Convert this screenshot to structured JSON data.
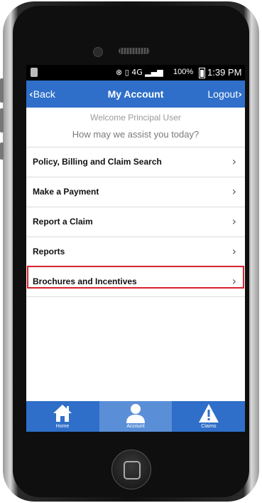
{
  "statusbar": {
    "battery": "100%",
    "time": "1:39 PM",
    "network": "4G"
  },
  "navbar": {
    "back_label": "Back",
    "title": "My Account",
    "logout_label": "Logout"
  },
  "welcome_text": "Welcome Principal User",
  "assist_text": "How may we assist you today?",
  "menu": {
    "items": [
      {
        "label": "Policy, Billing and Claim Search"
      },
      {
        "label": "Make a Payment"
      },
      {
        "label": "Report a Claim"
      },
      {
        "label": "Reports"
      },
      {
        "label": "Brochures and Incentives"
      }
    ]
  },
  "tabs": [
    {
      "label": "Home",
      "icon": "home-icon"
    },
    {
      "label": "Account",
      "icon": "user-icon"
    },
    {
      "label": "Claims",
      "icon": "warning-icon"
    }
  ],
  "colors": {
    "brand_blue": "#2f6fc9",
    "active_tab": "#5a8fd8",
    "highlight_red": "#d9232f"
  }
}
